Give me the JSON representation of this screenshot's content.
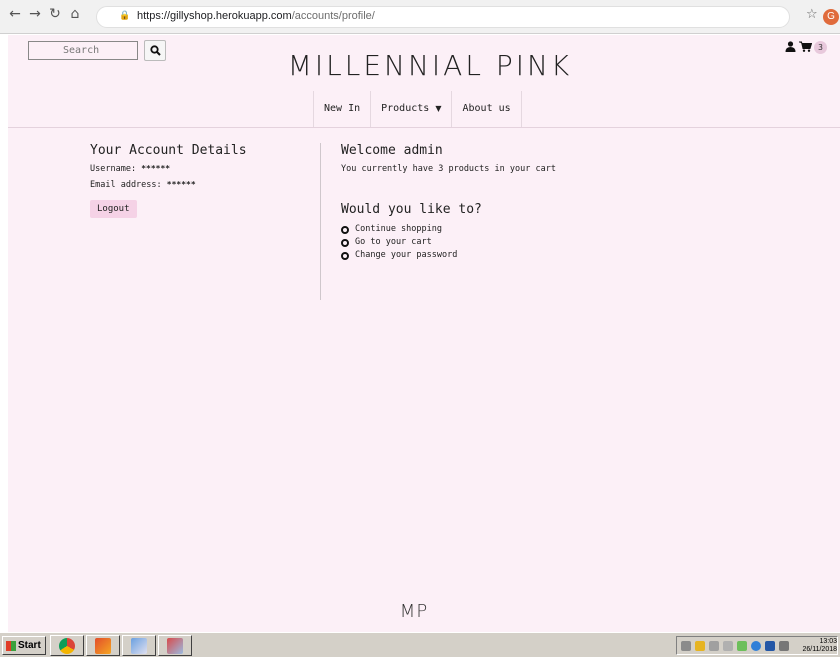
{
  "browser": {
    "url_host": "https://gillyshop.herokuapp.com",
    "url_path": "/accounts/profile/",
    "profile_initial": "G"
  },
  "header": {
    "search_placeholder": "Search",
    "logo_text": "MILLENNIAL PINK",
    "cart_count": "3"
  },
  "nav": {
    "items": [
      {
        "label": "New In"
      },
      {
        "label": "Products"
      },
      {
        "label": "About us"
      }
    ]
  },
  "account": {
    "title": "Your Account Details",
    "username_label": "Username:",
    "username_value": "******",
    "email_label": "Email address:",
    "email_value": "******",
    "logout_label": "Logout"
  },
  "welcome": {
    "title": "Welcome admin",
    "cart_message": "You currently have 3 products in your cart",
    "question": "Would you like to?",
    "actions": [
      {
        "label": "Continue shopping"
      },
      {
        "label": "Go to your cart"
      },
      {
        "label": "Change your password"
      }
    ]
  },
  "footer": {
    "logo_text": "MP"
  },
  "taskbar": {
    "start_label": "Start",
    "time": "13:03",
    "date": "26/11/2018"
  },
  "colors": {
    "page_bg": "#fcf0f7",
    "button_pink": "#f5d2e6",
    "badge_pink": "#e8c9dc"
  }
}
